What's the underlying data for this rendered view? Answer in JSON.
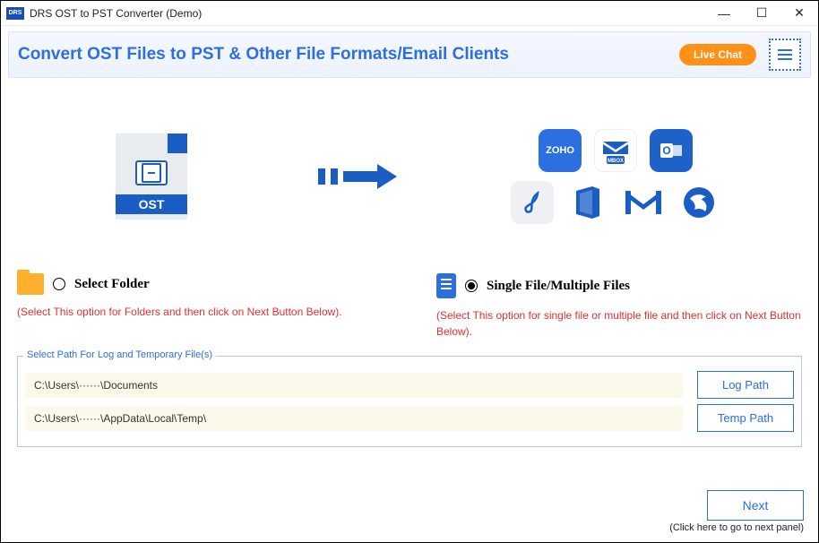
{
  "window": {
    "title": "DRS OST to PST Converter (Demo)",
    "logo_text": "DRS"
  },
  "topbar": {
    "title": "Convert OST Files to PST & Other File Formats/Email Clients",
    "live_chat_label": "Live Chat"
  },
  "hero": {
    "source_label": "OST",
    "target_icons": [
      "zoho-icon",
      "mbox-icon",
      "outlook-icon",
      "pdf-icon",
      "office-icon",
      "gmail-icon",
      "thunderbird-icon"
    ]
  },
  "options": {
    "folder": {
      "label": "Select Folder",
      "hint": "(Select This option for Folders and then click on Next Button Below).",
      "selected": false
    },
    "file": {
      "label": "Single File/Multiple Files",
      "hint": "(Select This option for single file or multiple file and then click on Next Button Below).",
      "selected": true
    }
  },
  "paths": {
    "legend": "Select Path For Log and Temporary File(s)",
    "log_value": "C:\\Users\\······\\Documents",
    "log_button": "Log Path",
    "temp_value": "C:\\Users\\······\\AppData\\Local\\Temp\\",
    "temp_button": "Temp Path"
  },
  "footer": {
    "next_label": "Next",
    "hint": "(Click here to go to next panel)"
  }
}
